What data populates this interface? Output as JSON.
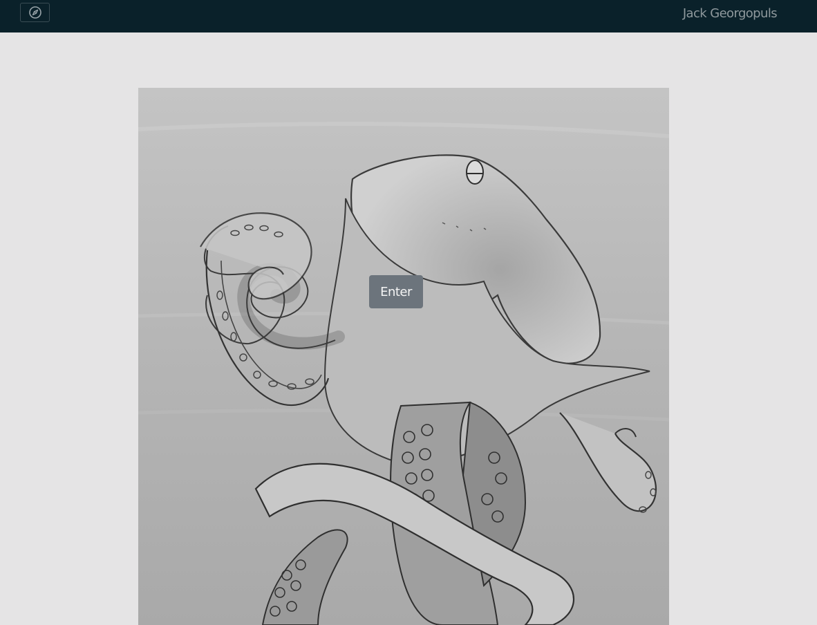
{
  "navbar": {
    "toggle_icon": "compass-icon",
    "brand": "Jack Georgopuls"
  },
  "hero": {
    "image_subject": "pencil-sketch-octopus",
    "enter_label": "Enter"
  },
  "colors": {
    "navbar_bg": "#0a212a",
    "page_bg": "#e5e4e5",
    "button_bg": "#6c747c",
    "brand_text": "#8f999d"
  }
}
